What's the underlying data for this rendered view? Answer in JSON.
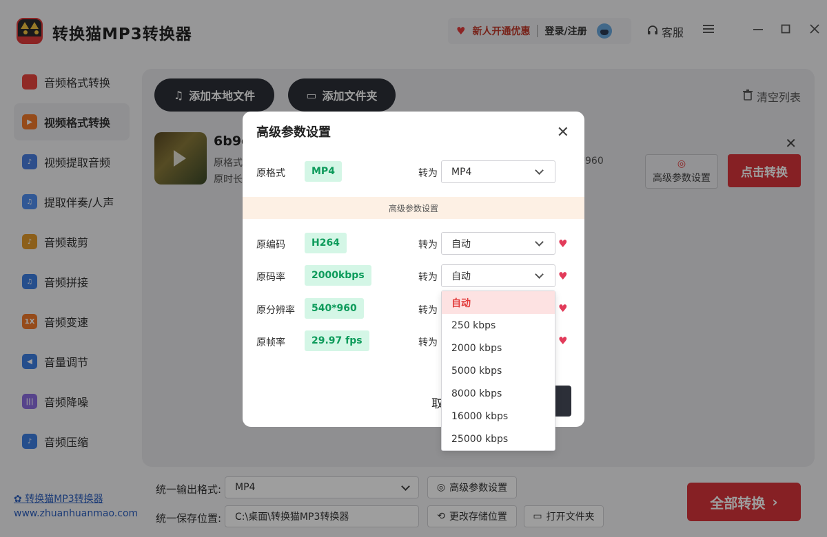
{
  "app": {
    "title": "转换猫MP3转换器",
    "promo_text": "新人开通优惠",
    "login_text": "登录/注册",
    "service_label": "客服",
    "icons": [
      "heart-icon",
      "avatar-icon",
      "headset-icon",
      "menu-icon",
      "minimize-icon",
      "maximize-icon",
      "close-icon"
    ]
  },
  "sidebar": {
    "items": [
      {
        "label": "音频格式转换",
        "icon": "audio-format-icon",
        "color": "#e9443e"
      },
      {
        "label": "视频格式转换",
        "icon": "video-format-icon",
        "color": "#f07a2b",
        "active": true
      },
      {
        "label": "视频提取音频",
        "icon": "video-extract-icon",
        "color": "#4a7ee0"
      },
      {
        "label": "提取伴奏/人声",
        "icon": "vocal-extract-icon",
        "color": "#4f8ef0"
      },
      {
        "label": "音频裁剪",
        "icon": "audio-cut-icon",
        "color": "#e39a2b"
      },
      {
        "label": "音频拼接",
        "icon": "audio-join-icon",
        "color": "#3d7fe3"
      },
      {
        "label": "音频变速",
        "icon": "audio-speed-icon",
        "color": "#f07a2b"
      },
      {
        "label": "音量调节",
        "icon": "volume-icon",
        "color": "#3d7fe3"
      },
      {
        "label": "音频降噪",
        "icon": "denoise-icon",
        "color": "#8c6ce0"
      },
      {
        "label": "音频压缩",
        "icon": "compress-icon",
        "color": "#3d7fe3"
      }
    ],
    "speed_icon_text": "1X",
    "footer_link": "转换猫MP3转换器",
    "footer_url": "www.zhuanhuanmao.com"
  },
  "main": {
    "add_file_label": "添加本地文件",
    "add_folder_label": "添加文件夹",
    "clear_label": "清空列表",
    "file": {
      "name": "6b9c",
      "meta1": "原格式",
      "meta2": "原时长",
      "resolution": "*960",
      "adv_label": "高级参数设置",
      "convert_label": "点击转换"
    }
  },
  "bottom": {
    "format_label": "统一输出格式:",
    "format_value": "MP4",
    "adv_label": "高级参数设置",
    "save_label": "统一保存位置:",
    "save_path": "C:\\桌面\\转换猫MP3转换器",
    "change_path_label": "更改存储位置",
    "open_folder_label": "打开文件夹",
    "convert_all_label": "全部转换"
  },
  "dialog": {
    "title": "高级参数设置",
    "to_label": "转为",
    "format": {
      "label": "原格式",
      "value": "MP4",
      "target": "MP4"
    },
    "strip_text": "高级参数设置",
    "rows": [
      {
        "label": "原编码",
        "value": "H264",
        "target": "自动"
      },
      {
        "label": "原码率",
        "value": "2000kbps",
        "target": "自动"
      },
      {
        "label": "原分辨率",
        "value": "540*960",
        "target": ""
      },
      {
        "label": "原帧率",
        "value": "29.97 fps",
        "target": ""
      }
    ],
    "cancel_label": "取",
    "dropdown": {
      "options": [
        "自动",
        "250 kbps",
        "2000 kbps",
        "5000 kbps",
        "8000 kbps",
        "16000 kbps",
        "25000 kbps"
      ],
      "selected": "自动"
    }
  },
  "colors": {
    "accent_red": "#d8343a",
    "badge_green": "#0d9b5b",
    "badge_bg": "#d4f6e6",
    "dark_button": "#2c2f38"
  }
}
